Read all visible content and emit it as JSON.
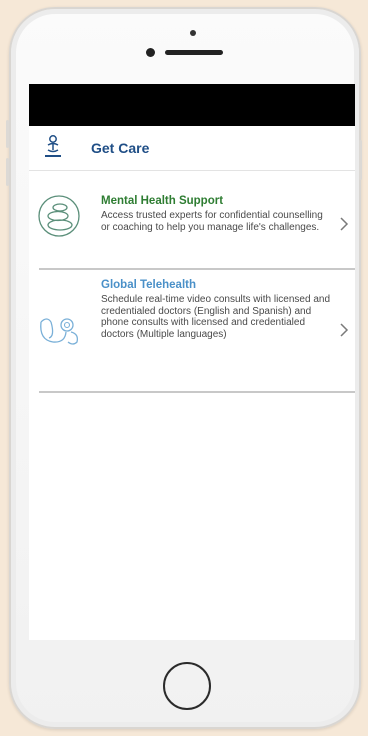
{
  "header": {
    "title": "Get Care",
    "icon": "person-care-icon"
  },
  "cards": [
    {
      "title": "Mental Health Support",
      "description": "Access trusted experts for confidential counselling or coaching to help you manage life's challenges.",
      "title_color": "#2e7d32",
      "icon": "stones-icon",
      "chevron": "chevron-right-icon"
    },
    {
      "title": "Global Telehealth",
      "description": "Schedule real-time video consults with licensed and credentialed doctors (English and Spanish) and phone consults with licensed and credentialed doctors (Multiple languages)",
      "title_color": "#4a90c8",
      "icon": "stethoscope-icon",
      "chevron": "chevron-right-icon"
    }
  ],
  "colors": {
    "accent": "#1f4e86",
    "background": "#f6e8d7",
    "status_bar": "#000000"
  }
}
